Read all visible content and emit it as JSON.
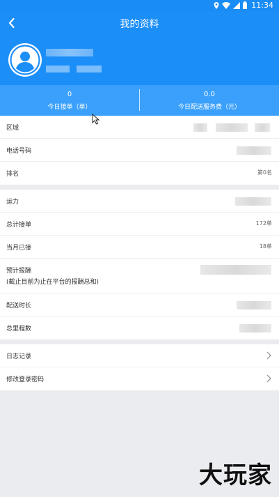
{
  "status_bar": {
    "time": "11:34"
  },
  "header": {
    "title": "我的资料"
  },
  "stats": {
    "orders_today": {
      "value": "0",
      "label": "今日接单（单）"
    },
    "fee_today": {
      "value": "0.0",
      "label": "今日配送服务费（元）"
    }
  },
  "profile_rows_1": [
    {
      "label": "区域"
    },
    {
      "label": "电话号码"
    },
    {
      "label": "排名",
      "value": "第0名"
    }
  ],
  "profile_rows_2": [
    {
      "label": "运力"
    },
    {
      "label": "总计接单",
      "value": "172单"
    },
    {
      "label": "当月已接",
      "value": "18单"
    },
    {
      "label": "预计报酬\n(截止目前为止在平台的报酬总和)"
    },
    {
      "label": "配送时长"
    },
    {
      "label": "总里程数"
    }
  ],
  "menu_rows": [
    {
      "label": "日志记录"
    },
    {
      "label": "修改登录密码"
    }
  ],
  "watermark": {
    "text": "大玩家"
  },
  "colors": {
    "primary": "#1b8ef8",
    "stats_bar": "#3aa0fb",
    "background": "#ebecef"
  },
  "icons": [
    "back-arrow-icon",
    "avatar-person-icon",
    "chevron-right-icon",
    "location-icon",
    "wifi-icon",
    "signal-icon",
    "battery-icon",
    "mouse-cursor-icon"
  ]
}
